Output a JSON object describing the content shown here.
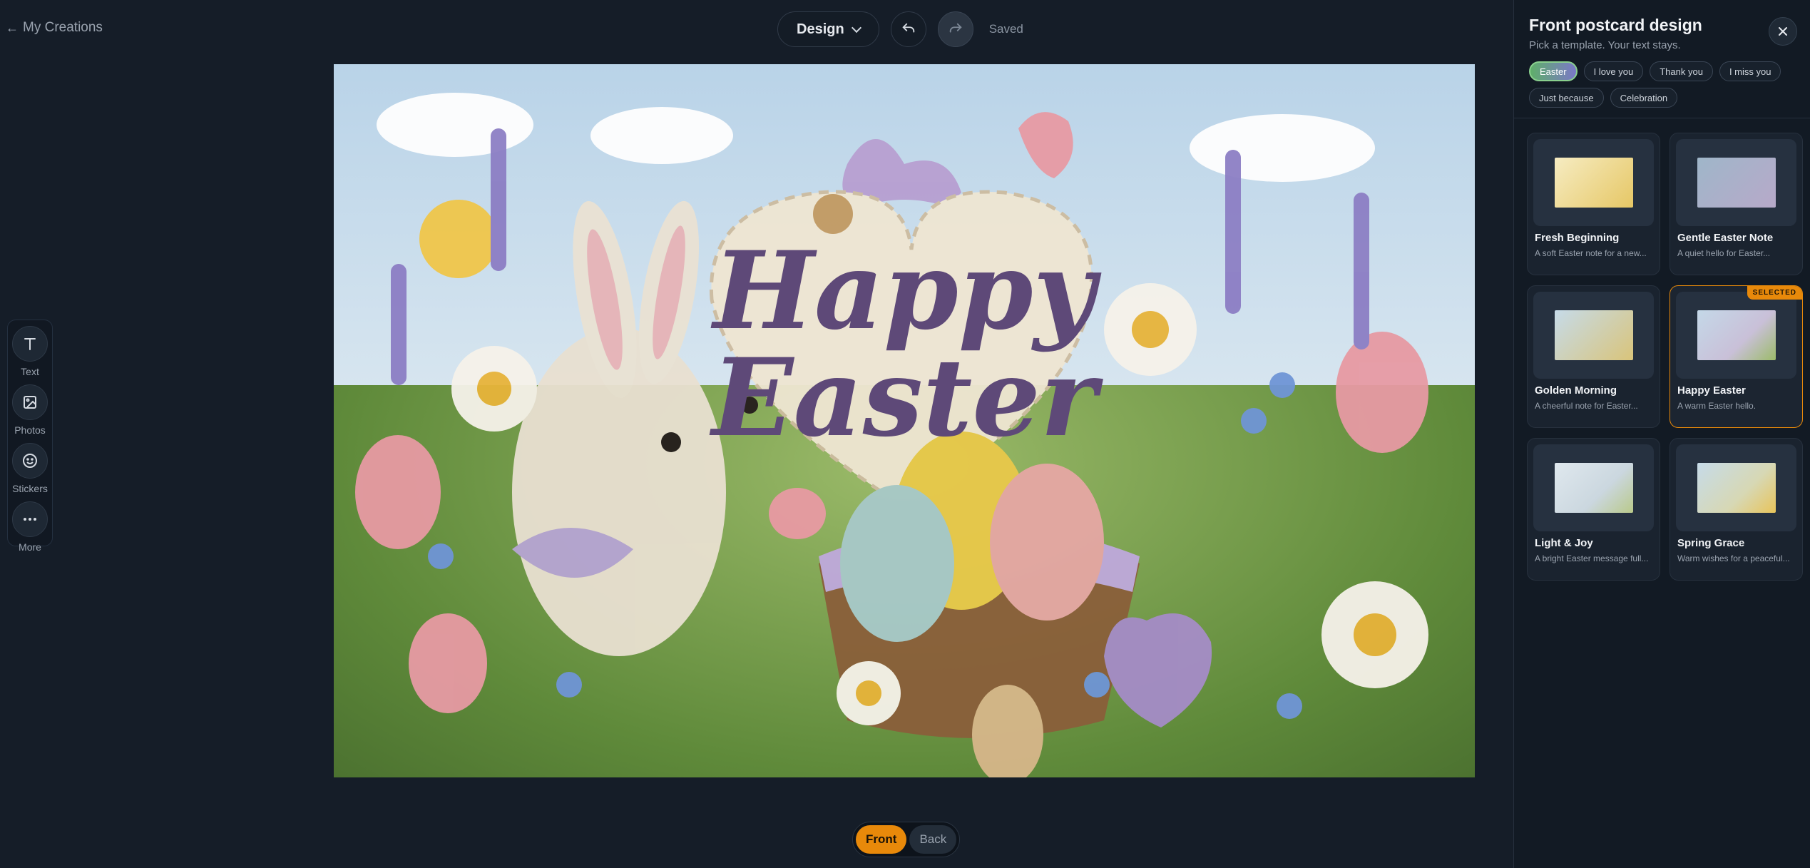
{
  "nav": {
    "back_label": "My Creations"
  },
  "toolbar": {
    "design_label": "Design",
    "status": "Saved"
  },
  "canvas": {
    "line1": "Happy",
    "line2": "Easter"
  },
  "tools": [
    {
      "label": "Text",
      "icon": "text-icon"
    },
    {
      "label": "Photos",
      "icon": "image-icon"
    },
    {
      "label": "Stickers",
      "icon": "smiley-icon"
    },
    {
      "label": "More",
      "icon": "more-icon"
    }
  ],
  "pager": {
    "front": "Front",
    "back": "Back",
    "active": "Front"
  },
  "panel": {
    "title": "Front postcard design",
    "subtitle": "Pick a template. Your text stays.",
    "chips": [
      "Easter",
      "I love you",
      "Thank you",
      "I miss you",
      "Just because",
      "Celebration"
    ],
    "active_chip": "Easter",
    "selected_badge": "SELECTED",
    "templates": [
      {
        "title": "Fresh Beginning",
        "desc": "A soft Easter note for a new...",
        "thumb_color": "#f3e6b5",
        "selected": false
      },
      {
        "title": "Gentle Easter Note",
        "desc": "A quiet hello for Easter...",
        "thumb_color": "#b7a9c9",
        "selected": false
      },
      {
        "title": "Golden Morning",
        "desc": "A cheerful note for Easter...",
        "thumb_color": "#d9c47a",
        "selected": false
      },
      {
        "title": "Happy Easter",
        "desc": "A warm Easter hello.",
        "thumb_color": "#c9c0d8",
        "selected": true
      },
      {
        "title": "Light & Joy",
        "desc": "A bright Easter message full...",
        "thumb_color": "#cbd7df",
        "selected": false
      },
      {
        "title": "Spring Grace",
        "desc": "Warm wishes for a peaceful...",
        "thumb_color": "#d7d8b4",
        "selected": false
      }
    ]
  },
  "colors": {
    "accent": "#e8890a",
    "background": "#151d28",
    "panel": "#121a24"
  }
}
